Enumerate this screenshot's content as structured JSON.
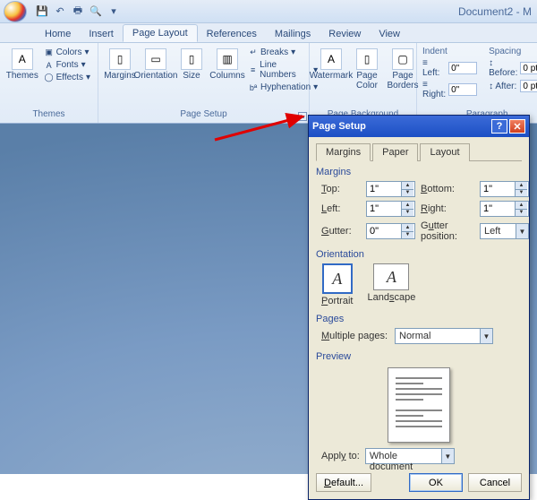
{
  "app": {
    "doc_title": "Document2 - M"
  },
  "tabs": [
    "Home",
    "Insert",
    "Page Layout",
    "References",
    "Mailings",
    "Review",
    "View"
  ],
  "active_tab": 2,
  "ribbon": {
    "themes": {
      "label": "Themes",
      "main": "Themes",
      "colors": "Colors",
      "fonts": "Fonts",
      "effects": "Effects"
    },
    "page_setup": {
      "label": "Page Setup",
      "margins": "Margins",
      "orientation": "Orientation",
      "size": "Size",
      "columns": "Columns",
      "breaks": "Breaks",
      "line_numbers": "Line Numbers",
      "hyphenation": "Hyphenation"
    },
    "page_bg": {
      "label": "Page Background",
      "watermark": "Watermark",
      "page_color": "Page Color",
      "page_borders": "Page Borders"
    },
    "paragraph": {
      "label": "Paragraph",
      "indent": "Indent",
      "spacing": "Spacing",
      "left_lbl": "Left:",
      "right_lbl": "Right:",
      "before_lbl": "Before:",
      "after_lbl": "After:",
      "left_val": "0\"",
      "right_val": "0\"",
      "before_val": "0 pt",
      "after_val": "0 pt"
    }
  },
  "dialog": {
    "title": "Page Setup",
    "tabs": [
      "Margins",
      "Paper",
      "Layout"
    ],
    "active_tab": 0,
    "sections": {
      "margins": "Margins",
      "orientation": "Orientation",
      "pages": "Pages",
      "preview": "Preview"
    },
    "margins": {
      "top_lbl": "Top:",
      "top_val": "1\"",
      "bottom_lbl": "Bottom:",
      "bottom_val": "1\"",
      "left_lbl": "Left:",
      "left_val": "1\"",
      "right_lbl": "Right:",
      "right_val": "1\"",
      "gutter_lbl": "Gutter:",
      "gutter_val": "0\"",
      "gutter_pos_lbl": "Gutter position:",
      "gutter_pos_val": "Left"
    },
    "orientation": {
      "portrait": "Portrait",
      "landscape": "Landscape",
      "selected": "portrait"
    },
    "pages": {
      "label": "Multiple pages:",
      "value": "Normal"
    },
    "apply": {
      "label": "Apply to:",
      "value": "Whole document"
    },
    "buttons": {
      "default": "Default...",
      "ok": "OK",
      "cancel": "Cancel"
    }
  }
}
